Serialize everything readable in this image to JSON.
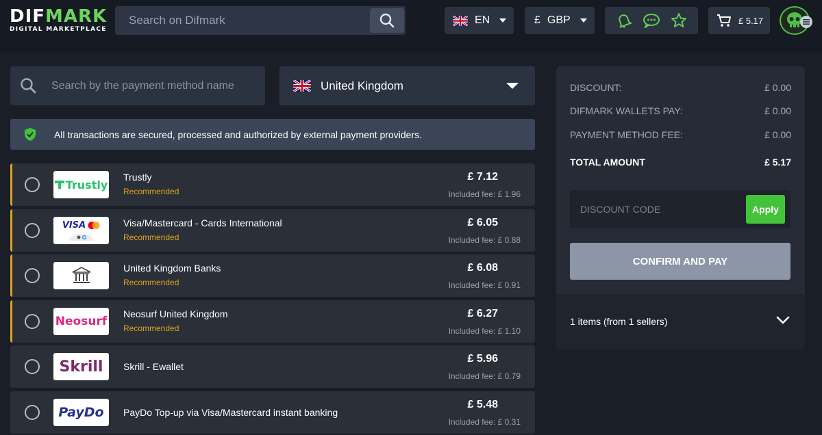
{
  "header": {
    "logo_main_a": "DIF",
    "logo_main_b": "MARK",
    "logo_sub": "DIGITAL MARKETPLACE",
    "search_placeholder": "Search on Difmark",
    "language": "EN",
    "currency_symbol": "£",
    "currency": "GBP",
    "cart_total": "£ 5.17",
    "accent_color": "#6cd45f"
  },
  "filters": {
    "method_search_placeholder": "Search by the payment method name",
    "country": "United Kingdom"
  },
  "notice": "All transactions are secured, processed and authorized by external payment providers.",
  "methods": [
    {
      "logo": "Trustly",
      "name": "Trustly",
      "tag": "Recommended",
      "price": "£ 7.12",
      "fee": "Included fee: £ 1.96"
    },
    {
      "logo": "VISA",
      "name": "Visa/Mastercard - Cards International",
      "tag": "Recommended",
      "price": "£ 6.05",
      "fee": "Included fee: £ 0.88"
    },
    {
      "logo": "bank-icon",
      "name": "United Kingdom Banks",
      "tag": "Recommended",
      "price": "£ 6.08",
      "fee": "Included fee: £ 0.91"
    },
    {
      "logo": "Neosurf",
      "name": "Neosurf United Kingdom",
      "tag": "Recommended",
      "price": "£ 6.27",
      "fee": "Included fee: £ 1.10"
    },
    {
      "logo": "Skrill",
      "name": "Skrill - Ewallet",
      "tag": "",
      "price": "£ 5.96",
      "fee": "Included fee: £ 0.79"
    },
    {
      "logo": "PayDo",
      "name": "PayDo Top-up via Visa/Mastercard instant banking",
      "tag": "",
      "price": "£ 5.48",
      "fee": "Included fee: £ 0.31"
    }
  ],
  "summary": {
    "discount_label": "DISCOUNT:",
    "discount_value": "£ 0.00",
    "wallets_label": "DIFMARK WALLETS PAY:",
    "wallets_value": "£ 0.00",
    "fee_label": "PAYMENT METHOD FEE:",
    "fee_value": "£ 0.00",
    "total_label": "TOTAL AMOUNT",
    "total_value": "£ 5.17",
    "discount_placeholder": "DISCOUNT CODE",
    "apply_label": "Apply",
    "confirm_label": "CONFIRM AND PAY",
    "items_text": "1 items (from 1 sellers)"
  }
}
